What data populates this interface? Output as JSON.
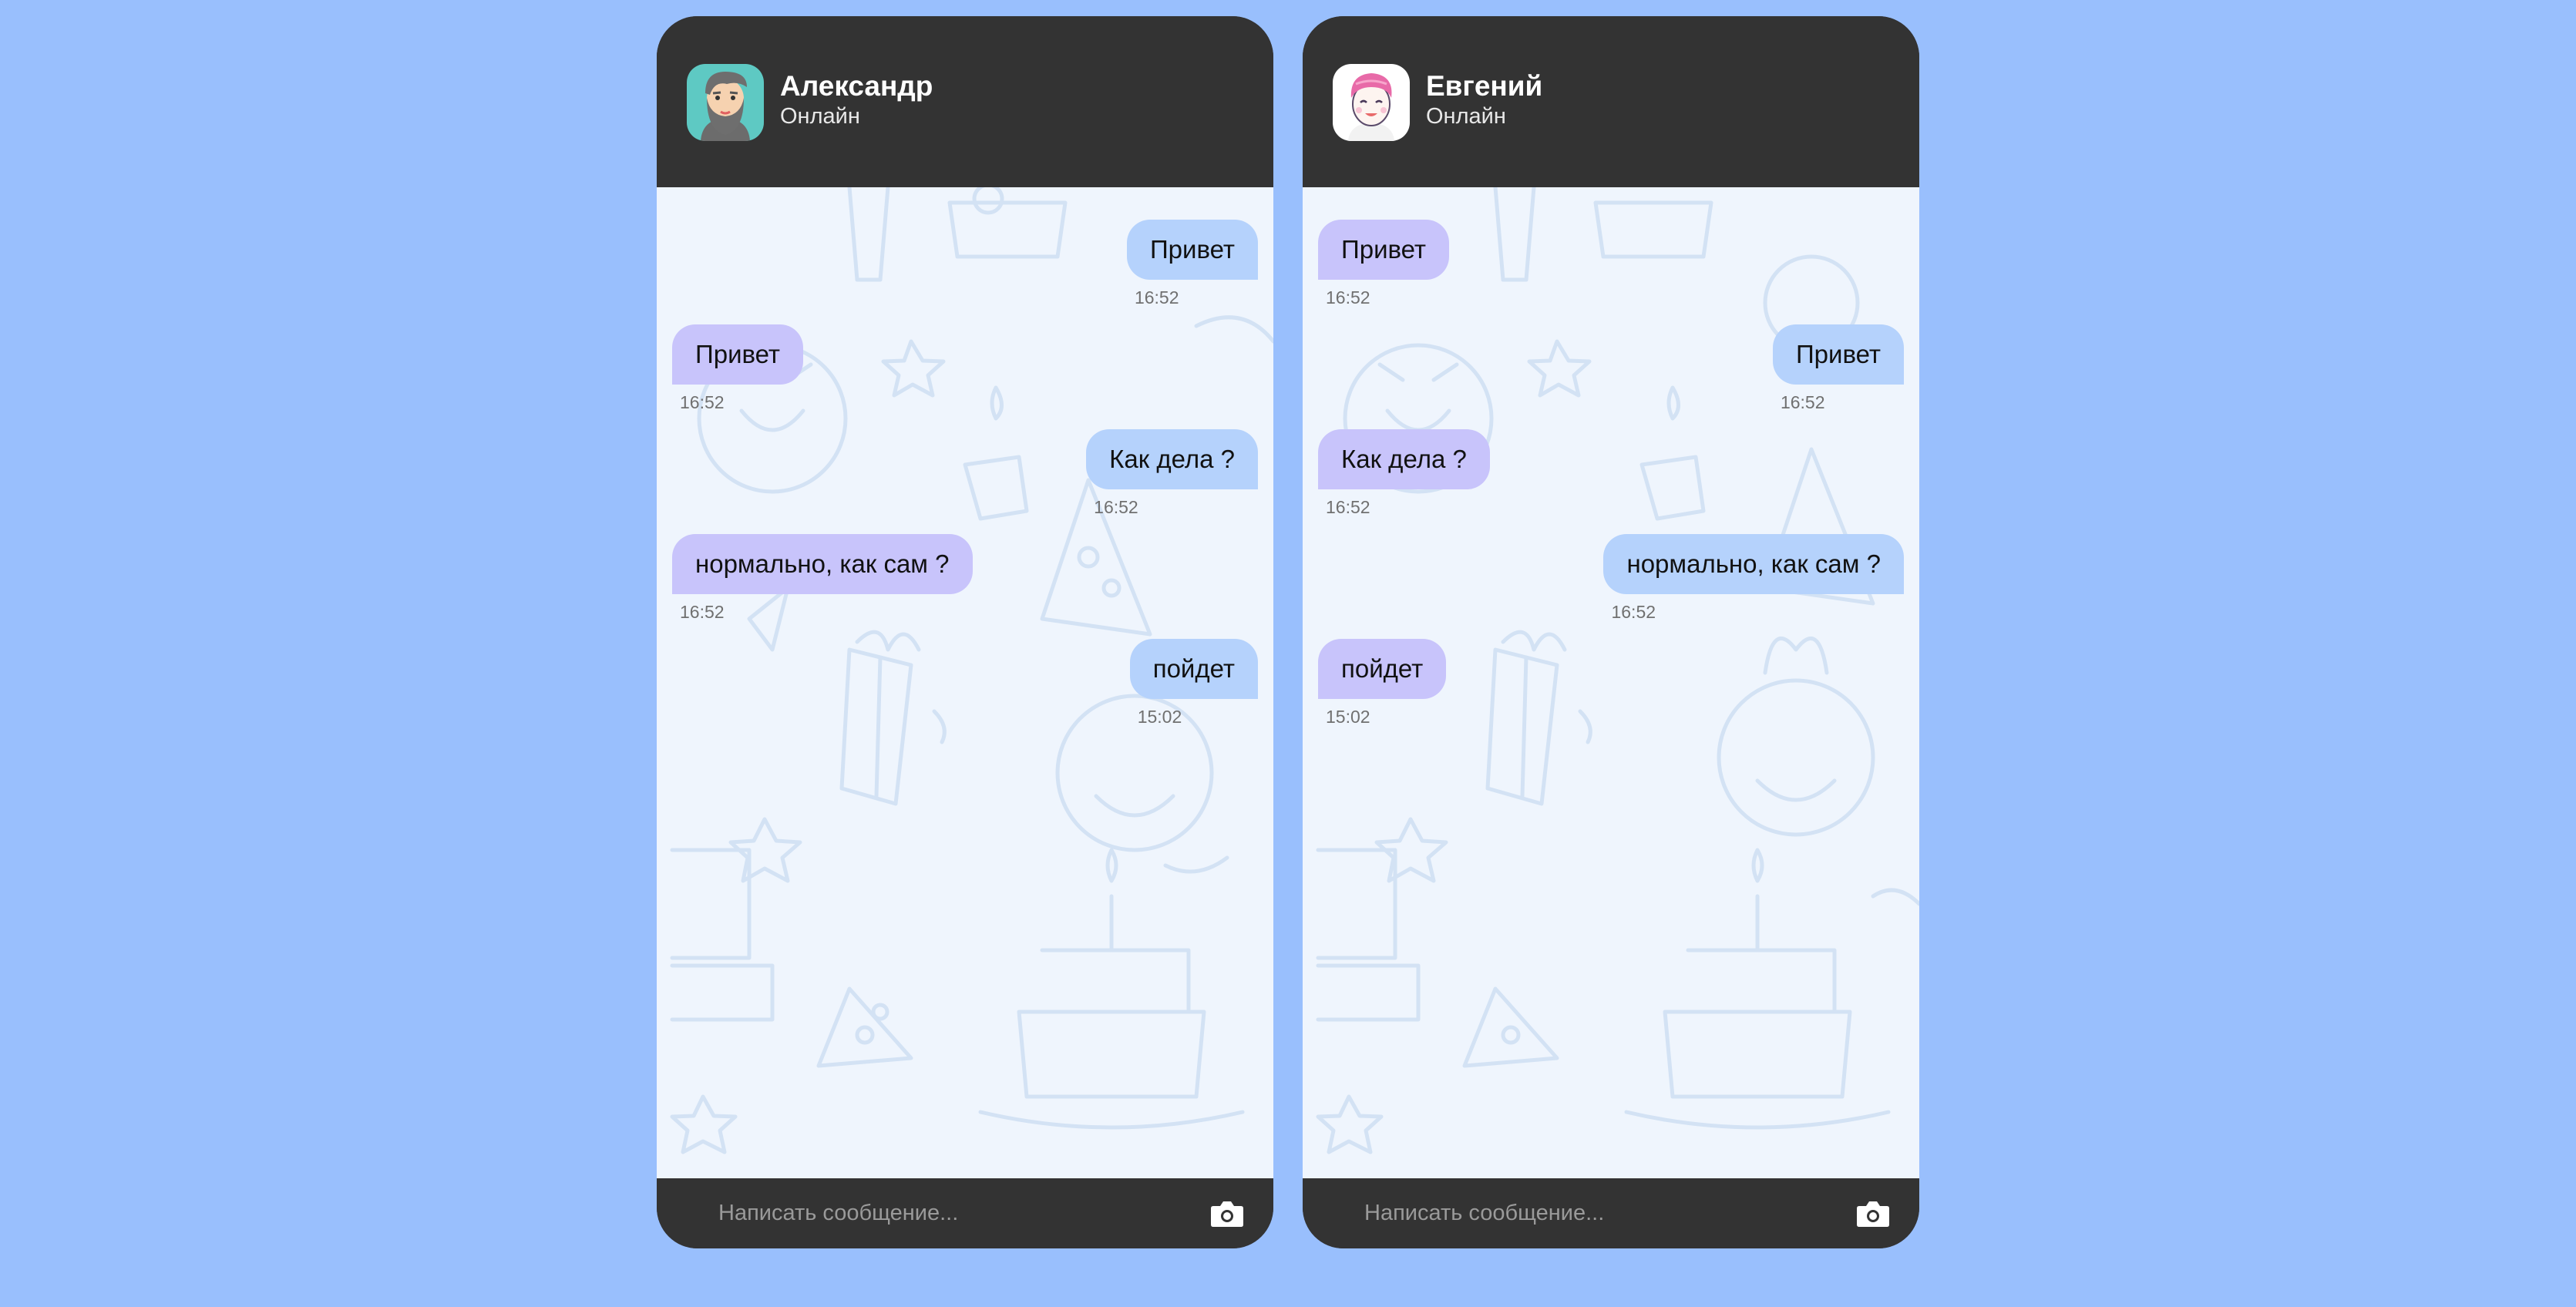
{
  "colors": {
    "page_background": "#99bffd",
    "panel_dark": "#333333",
    "chat_background": "#eff5fd",
    "incoming_bubble": "#c8c4fb",
    "outgoing_bubble": "#b5d2fc",
    "timestamp": "#707070"
  },
  "chats": [
    {
      "contact": {
        "name": "Александр",
        "status": "Онлайн",
        "avatar_icon": "bearded-man-avatar-icon"
      },
      "messages": [
        {
          "direction": "out",
          "text": "Привет",
          "time": "16:52"
        },
        {
          "direction": "in",
          "text": "Привет",
          "time": "16:52"
        },
        {
          "direction": "out",
          "text": "Как дела ?",
          "time": "16:52"
        },
        {
          "direction": "in",
          "text": "нормально, как сам ?",
          "time": "16:52"
        },
        {
          "direction": "out",
          "text": "пойдет",
          "time": "15:02"
        }
      ],
      "composer": {
        "placeholder": "Написать сообщение...",
        "camera_icon": "camera-icon"
      }
    },
    {
      "contact": {
        "name": "Евгений",
        "status": "Онлайн",
        "avatar_icon": "pink-haired-person-avatar-icon"
      },
      "messages": [
        {
          "direction": "in",
          "text": "Привет",
          "time": "16:52"
        },
        {
          "direction": "out",
          "text": "Привет",
          "time": "16:52"
        },
        {
          "direction": "in",
          "text": "Как дела ?",
          "time": "16:52"
        },
        {
          "direction": "out",
          "text": "нормально, как сам ?",
          "time": "16:52"
        },
        {
          "direction": "in",
          "text": "пойдет",
          "time": "15:02"
        }
      ],
      "composer": {
        "placeholder": "Написать сообщение...",
        "camera_icon": "camera-icon"
      }
    }
  ]
}
